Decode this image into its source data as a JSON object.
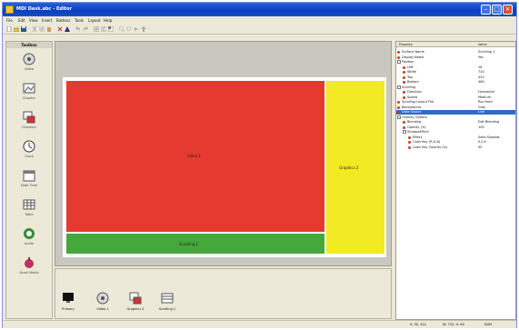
{
  "window": {
    "title": "MDI Desk.abc - Editor"
  },
  "menu": [
    "File",
    "Edit",
    "View",
    "Insert",
    "Buttons",
    "Tools",
    "Layout",
    "Help"
  ],
  "left_panel": {
    "title": "Toolbox",
    "tools": [
      {
        "label": "Video",
        "icon": "video-icon"
      },
      {
        "label": "Graphic",
        "icon": "graphic-icon"
      },
      {
        "label": "Graphics",
        "icon": "graphics-icon"
      },
      {
        "label": "Clock",
        "icon": "clock-icon"
      },
      {
        "label": "Date Time",
        "icon": "date-time-icon"
      },
      {
        "label": "Table",
        "icon": "table-icon"
      },
      {
        "label": "Audio",
        "icon": "audio-icon"
      },
      {
        "label": "Scroll Media",
        "icon": "scroll-media-icon"
      }
    ]
  },
  "layout": {
    "panes": [
      {
        "label": "Video 1",
        "color": "#e63a30"
      },
      {
        "label": "Graphics 2",
        "color": "#f2ea22"
      },
      {
        "label": "Scrolling 1",
        "color": "#45a83a"
      }
    ]
  },
  "tray": {
    "items": [
      {
        "label": "Primary",
        "icon": "monitor-icon"
      },
      {
        "label": "Video 1",
        "icon": "video-icon"
      },
      {
        "label": "Graphics 2",
        "icon": "graphics-icon"
      },
      {
        "label": "Scrolling 1",
        "icon": "scrolling-icon"
      }
    ]
  },
  "properties": {
    "header": {
      "name": "Property",
      "value": "Value"
    },
    "rows": [
      {
        "name": "Surface Name",
        "value": "Scrolling 1",
        "level": 1,
        "marker": "dot"
      },
      {
        "name": "Display Name",
        "value": "Yes",
        "level": 1,
        "marker": "dot"
      },
      {
        "name": "Position",
        "value": "",
        "level": 1,
        "marker": "box"
      },
      {
        "name": "Left",
        "value": "18",
        "level": 2,
        "marker": "dot"
      },
      {
        "name": "Width",
        "value": "720",
        "level": 2,
        "marker": "dot"
      },
      {
        "name": "Top",
        "value": "420",
        "level": 2,
        "marker": "dot"
      },
      {
        "name": "Bottom",
        "value": "480",
        "level": 2,
        "marker": "dot"
      },
      {
        "name": "Scrolling",
        "value": "",
        "level": 1,
        "marker": "box"
      },
      {
        "name": "Direction",
        "value": "Horizontal",
        "level": 2,
        "marker": "dot"
      },
      {
        "name": "Speed",
        "value": "Medium",
        "level": 2,
        "marker": "dot"
      },
      {
        "name": "Scrolling Layout File",
        "value": "Rss Feed",
        "level": 1,
        "marker": "dot"
      },
      {
        "name": "Background",
        "value": "Gray",
        "level": 1,
        "marker": "dot"
      },
      {
        "name": "Data Source",
        "value": "Live",
        "level": 1,
        "marker": "dot",
        "selected": true
      },
      {
        "name": "Overlay Options",
        "value": "",
        "level": 1,
        "marker": "box"
      },
      {
        "name": "Blending",
        "value": "Edit Blending",
        "level": 2,
        "marker": "dot"
      },
      {
        "name": "Opacity (%)",
        "value": "100",
        "level": 2,
        "marker": "dot"
      },
      {
        "name": "ShadowEffect",
        "value": "",
        "level": 2,
        "marker": "box"
      },
      {
        "name": "Effect",
        "value": "Solid Shadow",
        "level": 3,
        "marker": "dot"
      },
      {
        "name": "Color Key (R,G,B)",
        "value": "0,0,0",
        "level": 3,
        "marker": "dot"
      },
      {
        "name": "Color Key Opacity (%)",
        "value": "90",
        "level": 3,
        "marker": "dot"
      }
    ]
  },
  "status": {
    "position": "X: 50, 422",
    "size": "W: 720, H: 60",
    "zoom": "NUM"
  }
}
